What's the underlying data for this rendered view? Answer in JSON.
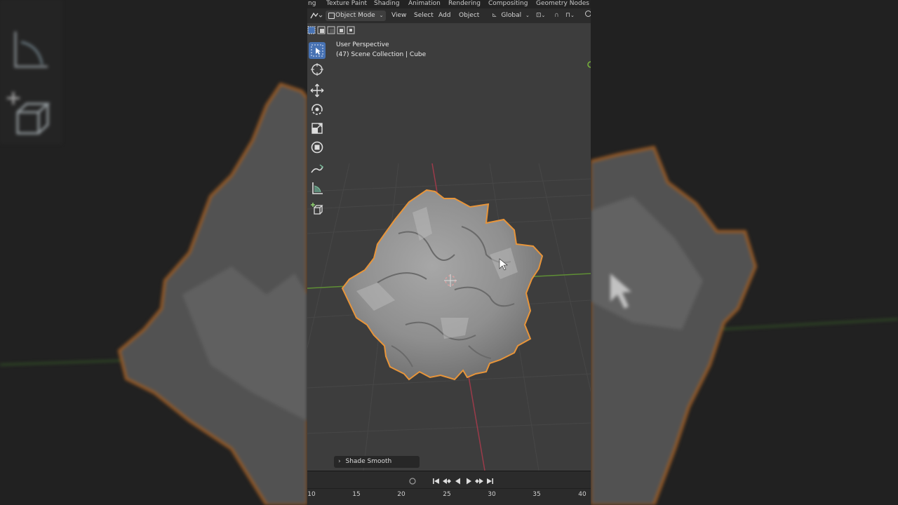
{
  "workspace_tabs": [
    "ng",
    "Texture Paint",
    "Shading",
    "Animation",
    "Rendering",
    "Compositing",
    "Geometry Nodes"
  ],
  "header": {
    "mode": "Object Mode",
    "menus": [
      "View",
      "Select",
      "Add",
      "Object"
    ],
    "orientation": "Global"
  },
  "viewport": {
    "view_name": "User Perspective",
    "collection_info": "(47) Scene Collection | Cube"
  },
  "operator_panel": {
    "label": "Shade Smooth"
  },
  "timeline": {
    "frames": [
      "10",
      "15",
      "20",
      "25",
      "30",
      "35",
      "40"
    ]
  },
  "colors": {
    "selection_outline": "#e8953a",
    "active_tool": "#4772b3",
    "x_axis": "#b04050",
    "y_axis": "#6a9a3a"
  },
  "icons": [
    "select-box-icon",
    "cursor-icon",
    "move-icon",
    "rotate-icon",
    "scale-icon",
    "transform-icon",
    "annotate-icon",
    "measure-icon",
    "add-cube-icon"
  ]
}
